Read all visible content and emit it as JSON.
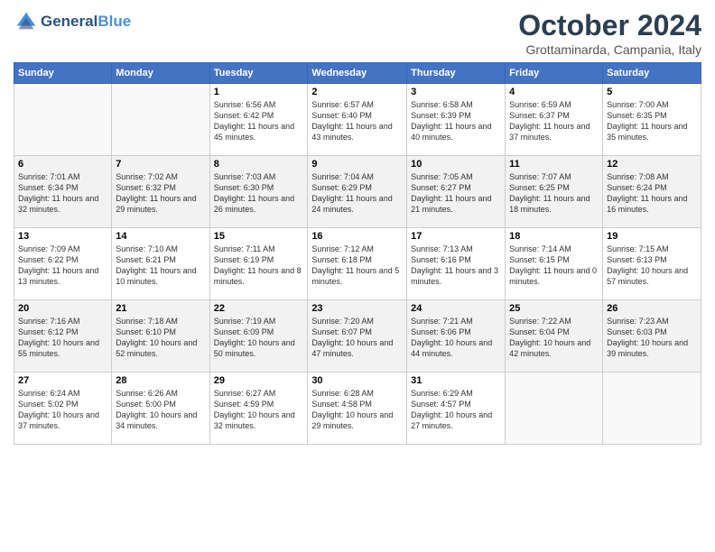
{
  "header": {
    "logo_line1": "General",
    "logo_line2": "Blue",
    "month": "October 2024",
    "location": "Grottaminarda, Campania, Italy"
  },
  "weekdays": [
    "Sunday",
    "Monday",
    "Tuesday",
    "Wednesday",
    "Thursday",
    "Friday",
    "Saturday"
  ],
  "weeks": [
    [
      {
        "day": "",
        "sunrise": "",
        "sunset": "",
        "daylight": ""
      },
      {
        "day": "",
        "sunrise": "",
        "sunset": "",
        "daylight": ""
      },
      {
        "day": "1",
        "sunrise": "Sunrise: 6:56 AM",
        "sunset": "Sunset: 6:42 PM",
        "daylight": "Daylight: 11 hours and 45 minutes."
      },
      {
        "day": "2",
        "sunrise": "Sunrise: 6:57 AM",
        "sunset": "Sunset: 6:40 PM",
        "daylight": "Daylight: 11 hours and 43 minutes."
      },
      {
        "day": "3",
        "sunrise": "Sunrise: 6:58 AM",
        "sunset": "Sunset: 6:39 PM",
        "daylight": "Daylight: 11 hours and 40 minutes."
      },
      {
        "day": "4",
        "sunrise": "Sunrise: 6:59 AM",
        "sunset": "Sunset: 6:37 PM",
        "daylight": "Daylight: 11 hours and 37 minutes."
      },
      {
        "day": "5",
        "sunrise": "Sunrise: 7:00 AM",
        "sunset": "Sunset: 6:35 PM",
        "daylight": "Daylight: 11 hours and 35 minutes."
      }
    ],
    [
      {
        "day": "6",
        "sunrise": "Sunrise: 7:01 AM",
        "sunset": "Sunset: 6:34 PM",
        "daylight": "Daylight: 11 hours and 32 minutes."
      },
      {
        "day": "7",
        "sunrise": "Sunrise: 7:02 AM",
        "sunset": "Sunset: 6:32 PM",
        "daylight": "Daylight: 11 hours and 29 minutes."
      },
      {
        "day": "8",
        "sunrise": "Sunrise: 7:03 AM",
        "sunset": "Sunset: 6:30 PM",
        "daylight": "Daylight: 11 hours and 26 minutes."
      },
      {
        "day": "9",
        "sunrise": "Sunrise: 7:04 AM",
        "sunset": "Sunset: 6:29 PM",
        "daylight": "Daylight: 11 hours and 24 minutes."
      },
      {
        "day": "10",
        "sunrise": "Sunrise: 7:05 AM",
        "sunset": "Sunset: 6:27 PM",
        "daylight": "Daylight: 11 hours and 21 minutes."
      },
      {
        "day": "11",
        "sunrise": "Sunrise: 7:07 AM",
        "sunset": "Sunset: 6:25 PM",
        "daylight": "Daylight: 11 hours and 18 minutes."
      },
      {
        "day": "12",
        "sunrise": "Sunrise: 7:08 AM",
        "sunset": "Sunset: 6:24 PM",
        "daylight": "Daylight: 11 hours and 16 minutes."
      }
    ],
    [
      {
        "day": "13",
        "sunrise": "Sunrise: 7:09 AM",
        "sunset": "Sunset: 6:22 PM",
        "daylight": "Daylight: 11 hours and 13 minutes."
      },
      {
        "day": "14",
        "sunrise": "Sunrise: 7:10 AM",
        "sunset": "Sunset: 6:21 PM",
        "daylight": "Daylight: 11 hours and 10 minutes."
      },
      {
        "day": "15",
        "sunrise": "Sunrise: 7:11 AM",
        "sunset": "Sunset: 6:19 PM",
        "daylight": "Daylight: 11 hours and 8 minutes."
      },
      {
        "day": "16",
        "sunrise": "Sunrise: 7:12 AM",
        "sunset": "Sunset: 6:18 PM",
        "daylight": "Daylight: 11 hours and 5 minutes."
      },
      {
        "day": "17",
        "sunrise": "Sunrise: 7:13 AM",
        "sunset": "Sunset: 6:16 PM",
        "daylight": "Daylight: 11 hours and 3 minutes."
      },
      {
        "day": "18",
        "sunrise": "Sunrise: 7:14 AM",
        "sunset": "Sunset: 6:15 PM",
        "daylight": "Daylight: 11 hours and 0 minutes."
      },
      {
        "day": "19",
        "sunrise": "Sunrise: 7:15 AM",
        "sunset": "Sunset: 6:13 PM",
        "daylight": "Daylight: 10 hours and 57 minutes."
      }
    ],
    [
      {
        "day": "20",
        "sunrise": "Sunrise: 7:16 AM",
        "sunset": "Sunset: 6:12 PM",
        "daylight": "Daylight: 10 hours and 55 minutes."
      },
      {
        "day": "21",
        "sunrise": "Sunrise: 7:18 AM",
        "sunset": "Sunset: 6:10 PM",
        "daylight": "Daylight: 10 hours and 52 minutes."
      },
      {
        "day": "22",
        "sunrise": "Sunrise: 7:19 AM",
        "sunset": "Sunset: 6:09 PM",
        "daylight": "Daylight: 10 hours and 50 minutes."
      },
      {
        "day": "23",
        "sunrise": "Sunrise: 7:20 AM",
        "sunset": "Sunset: 6:07 PM",
        "daylight": "Daylight: 10 hours and 47 minutes."
      },
      {
        "day": "24",
        "sunrise": "Sunrise: 7:21 AM",
        "sunset": "Sunset: 6:06 PM",
        "daylight": "Daylight: 10 hours and 44 minutes."
      },
      {
        "day": "25",
        "sunrise": "Sunrise: 7:22 AM",
        "sunset": "Sunset: 6:04 PM",
        "daylight": "Daylight: 10 hours and 42 minutes."
      },
      {
        "day": "26",
        "sunrise": "Sunrise: 7:23 AM",
        "sunset": "Sunset: 6:03 PM",
        "daylight": "Daylight: 10 hours and 39 minutes."
      }
    ],
    [
      {
        "day": "27",
        "sunrise": "Sunrise: 6:24 AM",
        "sunset": "Sunset: 5:02 PM",
        "daylight": "Daylight: 10 hours and 37 minutes."
      },
      {
        "day": "28",
        "sunrise": "Sunrise: 6:26 AM",
        "sunset": "Sunset: 5:00 PM",
        "daylight": "Daylight: 10 hours and 34 minutes."
      },
      {
        "day": "29",
        "sunrise": "Sunrise: 6:27 AM",
        "sunset": "Sunset: 4:59 PM",
        "daylight": "Daylight: 10 hours and 32 minutes."
      },
      {
        "day": "30",
        "sunrise": "Sunrise: 6:28 AM",
        "sunset": "Sunset: 4:58 PM",
        "daylight": "Daylight: 10 hours and 29 minutes."
      },
      {
        "day": "31",
        "sunrise": "Sunrise: 6:29 AM",
        "sunset": "Sunset: 4:57 PM",
        "daylight": "Daylight: 10 hours and 27 minutes."
      },
      {
        "day": "",
        "sunrise": "",
        "sunset": "",
        "daylight": ""
      },
      {
        "day": "",
        "sunrise": "",
        "sunset": "",
        "daylight": ""
      }
    ]
  ]
}
